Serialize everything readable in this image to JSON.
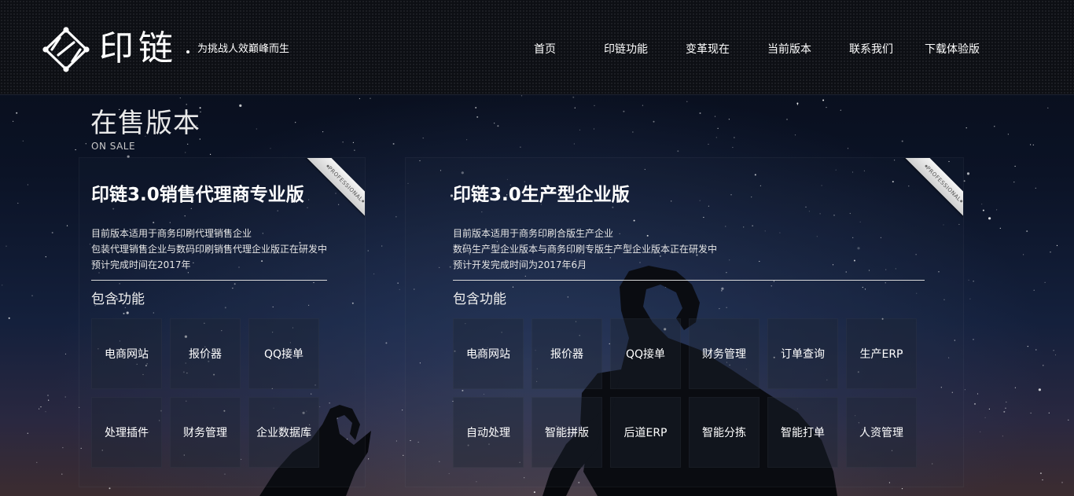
{
  "header": {
    "brand_name": "印链",
    "slogan": "为挑战人效巅峰而生",
    "nav": [
      {
        "label": "首页"
      },
      {
        "label": "印链功能"
      },
      {
        "label": "变革现在"
      },
      {
        "label": "当前版本"
      },
      {
        "label": "联系我们"
      },
      {
        "label": "下载体验版"
      }
    ]
  },
  "section": {
    "title": "在售版本",
    "subtitle": "ON SALE"
  },
  "products": [
    {
      "title": "印链3.0销售代理商专业版",
      "ribbon": "PROFESSIONAL",
      "desc": [
        "目前版本适用于商务印刷代理销售企业",
        "包装代理销售企业与数码印刷销售代理企业版正在研发中",
        "预计完成时间在2017年"
      ],
      "features_heading": "包含功能",
      "features": [
        "电商网站",
        "报价器",
        "QQ接单",
        "处理插件",
        "财务管理",
        "企业数据库"
      ]
    },
    {
      "title": "印链3.0生产型企业版",
      "ribbon": "PROFESSIONAL",
      "desc": [
        "目前版本适用于商务印刷合版生产企业",
        "数码生产型企业版本与商务印刷专版生产型企业版本正在研发中",
        "预计开发完成时间为2017年6月"
      ],
      "features_heading": "包含功能",
      "features": [
        "电商网站",
        "报价器",
        "QQ接单",
        "财务管理",
        "订单查询",
        "生产ERP",
        "自动处理",
        "智能拼版",
        "后道ERP",
        "智能分拣",
        "智能打单",
        "人资管理"
      ]
    }
  ]
}
